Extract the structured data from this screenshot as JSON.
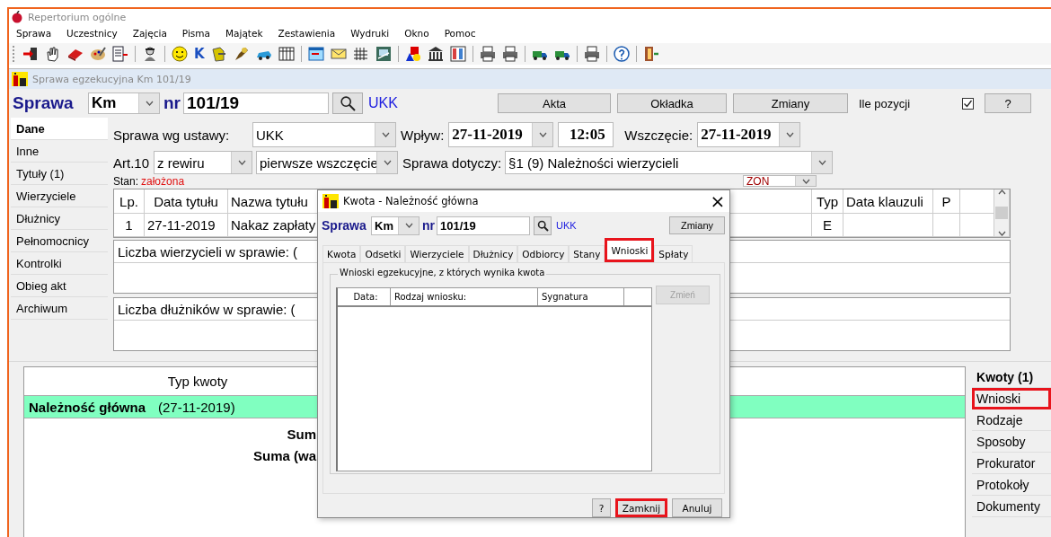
{
  "app": {
    "title": "Repertorium ogólne",
    "menu": [
      "Sprawa",
      "Uczestnicy",
      "Zajęcia",
      "Pisma",
      "Majątek",
      "Zestawienia",
      "Wydruki",
      "Okno",
      "Pomoc"
    ],
    "toolbar_glyph": "K"
  },
  "case_window": {
    "title": "Sprawa egzekucyjna  Km 101/19",
    "header": {
      "label": "Sprawa",
      "type": "Km",
      "nr_label": "nr",
      "number": "101/19",
      "court": "UKK",
      "buttons": [
        "Akta",
        "Okładka",
        "Zmiany"
      ],
      "count_label": "Ile pozycji",
      "count_checked": true,
      "help": "?"
    },
    "left_tabs": [
      {
        "label": "Dane",
        "selected": true
      },
      {
        "label": "Inne",
        "selected": false
      },
      {
        "label": "Tytuły (1)",
        "selected": false
      },
      {
        "label": "Wierzyciele",
        "selected": false
      },
      {
        "label": "Dłużnicy",
        "selected": false
      },
      {
        "label": "Pełnomocnicy",
        "selected": false
      },
      {
        "label": "Kontrolki",
        "selected": false
      },
      {
        "label": "Obieg akt",
        "selected": false
      },
      {
        "label": "Archiwum",
        "selected": false
      }
    ],
    "form": {
      "act_label": "Sprawa wg ustawy:",
      "act": "UKK",
      "received_label": "Wpływ:",
      "received_date": "27-11-2019",
      "received_time": "12:05",
      "started_label": "Wszczęcie:",
      "started_date": "27-11-2019",
      "art_label": "Art.10",
      "art": "z rewiru",
      "initiation": "pierwsze wszczęcie",
      "concerns_label": "Sprawa dotyczy:",
      "concerns": "§1 (9) Należności wierzycieli",
      "state_label": "Stan:",
      "state": "założona",
      "field_3": "ZON"
    },
    "titles_table": {
      "columns": [
        "Lp.",
        "Data tytułu",
        "Nazwa tytułu",
        "Typ",
        "Data klauzuli",
        "P"
      ],
      "rows": [
        {
          "lp": "1",
          "date": "27-11-2019",
          "name": "Nakaz zapłaty",
          "type": "E"
        }
      ]
    },
    "creditors_label": "Liczba wierzycieli w sprawie: (",
    "debtors_label": "Liczba dłużników w sprawie: (",
    "amounts": {
      "column": "Typ kwoty",
      "rows": [
        {
          "name": "Należność główna",
          "date": "(27-11-2019)",
          "selected": true
        }
      ],
      "sum_labels": [
        "Sum",
        "Suma (wa"
      ]
    },
    "right_tabs": [
      {
        "label": "Kwoty (1)",
        "selected": true,
        "highlighted": false
      },
      {
        "label": "Wnioski",
        "selected": false,
        "highlighted": true
      },
      {
        "label": "Rodzaje",
        "selected": false,
        "highlighted": false
      },
      {
        "label": "Sposoby",
        "selected": false,
        "highlighted": false
      },
      {
        "label": "Prokurator",
        "selected": false,
        "highlighted": false
      },
      {
        "label": "Protokoły",
        "selected": false,
        "highlighted": false
      },
      {
        "label": "Dokumenty",
        "selected": false,
        "highlighted": false
      }
    ]
  },
  "dialog": {
    "title": "Kwota - Należność główna",
    "close": "×",
    "header": {
      "label": "Sprawa",
      "type": "Km",
      "nr_label": "nr",
      "number": "101/19",
      "court": "UKK",
      "button": "Zmiany"
    },
    "tabs": [
      {
        "label": "Kwota",
        "selected": false,
        "highlighted": false
      },
      {
        "label": "Odsetki",
        "selected": false,
        "highlighted": false
      },
      {
        "label": "Wierzyciele",
        "selected": false,
        "highlighted": false
      },
      {
        "label": "Dłużnicy",
        "selected": false,
        "highlighted": false
      },
      {
        "label": "Odbiorcy",
        "selected": false,
        "highlighted": false
      },
      {
        "label": "Stany",
        "selected": false,
        "highlighted": false
      },
      {
        "label": "Wnioski",
        "selected": true,
        "highlighted": true
      },
      {
        "label": "Spłaty",
        "selected": false,
        "highlighted": false
      }
    ],
    "group_title": "Wnioski egzekucyjne, z których wynika kwota",
    "columns": [
      "Data:",
      "Rodzaj wniosku:",
      "Sygnatura"
    ],
    "side_button": {
      "label": "Zmień",
      "disabled": true
    },
    "buttons": [
      {
        "label": "?",
        "highlighted": false
      },
      {
        "label": "Zamknij",
        "highlighted": true
      },
      {
        "label": "Anuluj",
        "highlighted": false
      }
    ]
  }
}
